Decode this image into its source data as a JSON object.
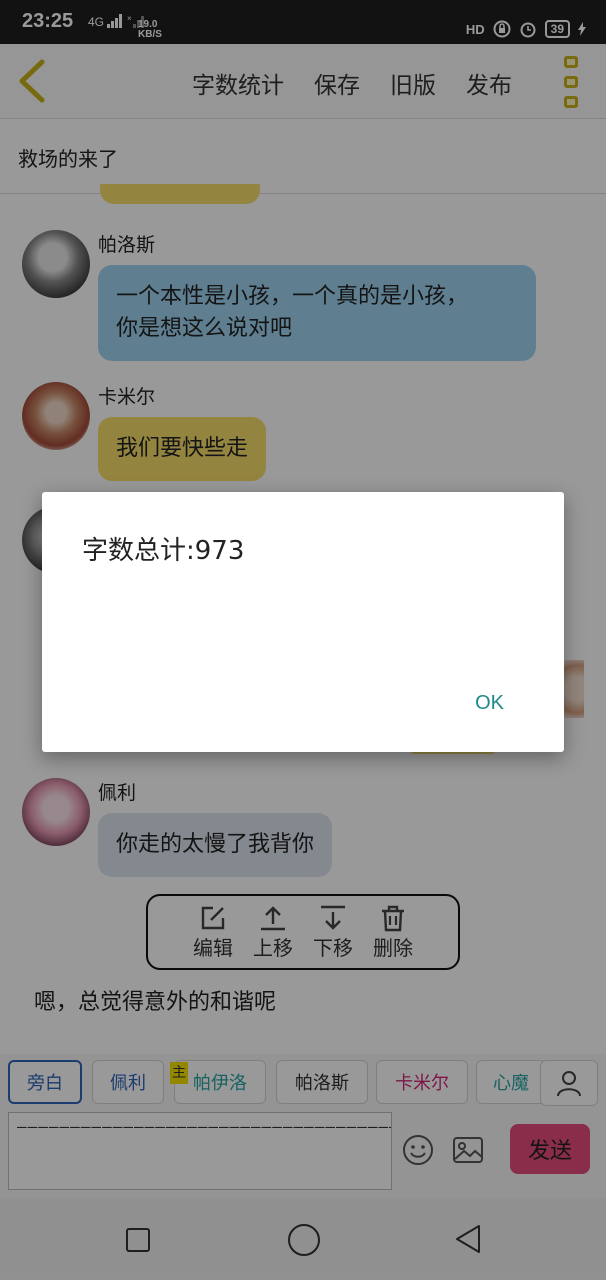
{
  "status_bar": {
    "time": "23:25",
    "signal_text": "4G",
    "speed_value": "19.0",
    "speed_unit": "KB/S",
    "hd_label": "HD",
    "battery": "39"
  },
  "app_bar": {
    "menu": [
      "字数统计",
      "保存",
      "旧版",
      "发布"
    ]
  },
  "story_title": "救场的来了",
  "messages": [
    {
      "name": "帕洛斯",
      "text_line1": "一个本性是小孩，一个真的是小孩，",
      "text_line2": "你是想这么说对吧"
    },
    {
      "name": "卡米尔",
      "text_line1": "我们要快些走"
    },
    {
      "name": "佩利",
      "text_line1": "你走的太慢了我背你"
    }
  ],
  "toolbox": {
    "tools": [
      {
        "label": "编辑",
        "icon": "edit-icon"
      },
      {
        "label": "上移",
        "icon": "move-up-icon"
      },
      {
        "label": "下移",
        "icon": "move-down-icon"
      },
      {
        "label": "删除",
        "icon": "trash-icon"
      }
    ]
  },
  "narration": "嗯，总觉得意外的和谐呢",
  "character_tabs": [
    {
      "label": "旁白",
      "color": "#2d64b8"
    },
    {
      "label": "佩利",
      "color": "#2d64b8"
    },
    {
      "label": "帕伊洛",
      "color": "#2aa3a3"
    },
    {
      "label": "帕洛斯",
      "color": "#333333"
    },
    {
      "label": "卡米尔",
      "color": "#d0287a"
    },
    {
      "label": "心魔",
      "color": "#2aa3a3"
    }
  ],
  "host_tag": "主",
  "input_text": "———————————————————————————————————————————————————————",
  "send_label": "发送",
  "dialog": {
    "message": "字数总计:973",
    "ok_label": "OK"
  }
}
